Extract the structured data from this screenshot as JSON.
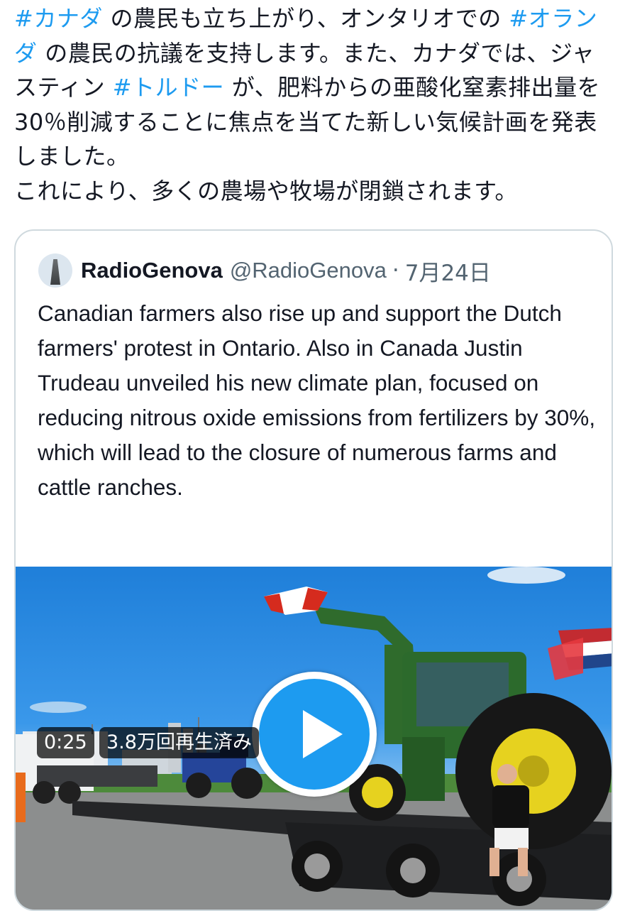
{
  "tweet": {
    "hashtag_1": "#カナダ",
    "text_1": " の農民も立ち上がり、オンタリオでの ",
    "hashtag_2": "#オランダ",
    "text_2": " の農民の抗議を支持します。また、カナダでは、ジャスティン ",
    "hashtag_3": "#トルドー",
    "text_3": " が、肥料からの亜酸化窒素排出量を30％削減することに焦点を当てた新しい気候計画を発表しました。",
    "text_4": "これにより、多くの農場や牧場が閉鎖されます。"
  },
  "quoted_tweet": {
    "author_name": "RadioGenova",
    "handle": "@RadioGenova",
    "separator": "·",
    "date": "7月24日",
    "text": "Canadian farmers also rise up and support the Dutch farmers' protest in Ontario. Also in Canada Justin Trudeau unveiled his new climate plan, focused on reducing nitrous oxide emissions from fertilizers by 30%, which will lead to the closure of numerous farms and cattle ranches.",
    "video": {
      "duration": "0:25",
      "views": "3.8万回再生済み",
      "play_icon": "play-icon"
    }
  },
  "colors": {
    "hashtag": "#1d9bf0",
    "text": "#141823",
    "secondary": "#536471",
    "card_border": "#cfd9de",
    "play_button": "#1d9bf0"
  }
}
